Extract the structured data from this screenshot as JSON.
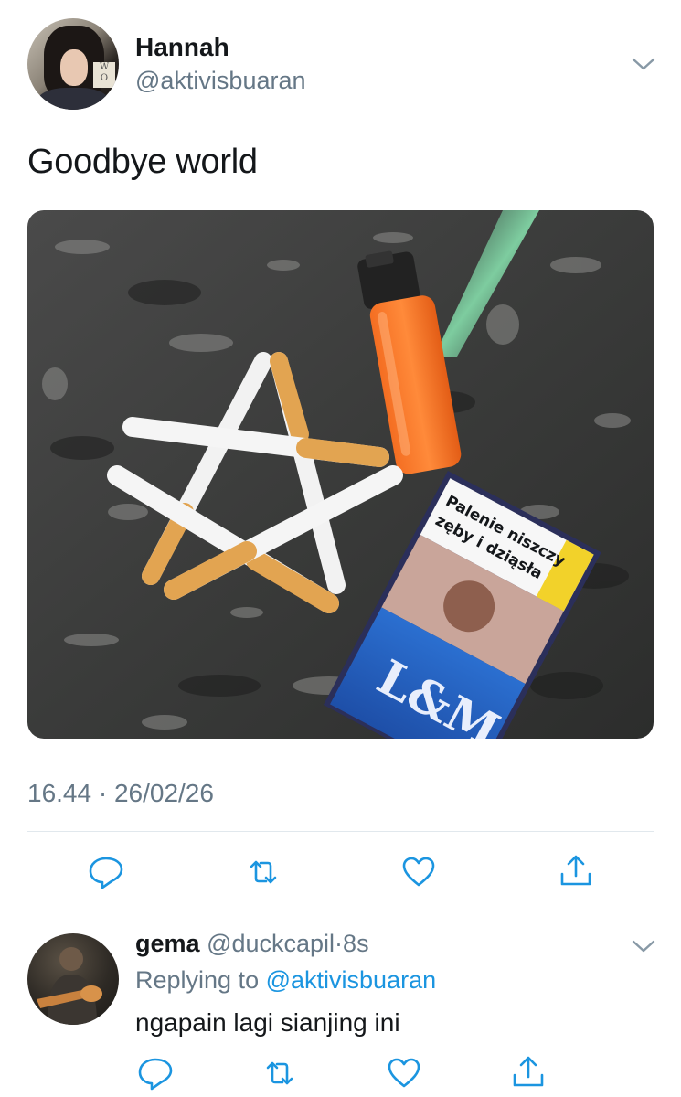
{
  "tweet": {
    "author": {
      "display_name": "Hannah",
      "handle": "@aktivisbuaran"
    },
    "text": "Goodbye world",
    "timestamp": "16.44 · 26/02/26",
    "media": {
      "pack_warning_line1": "Palenie niszczy",
      "pack_warning_line2": "zęby i dziąsła",
      "pack_brand": "L&M"
    }
  },
  "reply": {
    "display_name": "gema",
    "handle": "@duckcapil",
    "separator": "·",
    "time": "8s",
    "replying_prefix": "Replying to",
    "replying_handle": "@aktivisbuaran",
    "text": "ngapain lagi sianjing ini"
  },
  "colors": {
    "primary_text": "#14171a",
    "secondary_text": "#657786",
    "link": "#1b95e0",
    "divider": "#e1e8ed",
    "icon": "#1b95e0"
  },
  "icons": {
    "reply": "reply-icon",
    "retweet": "retweet-icon",
    "like": "heart-icon",
    "share": "share-icon",
    "menu": "chevron-down-icon"
  }
}
